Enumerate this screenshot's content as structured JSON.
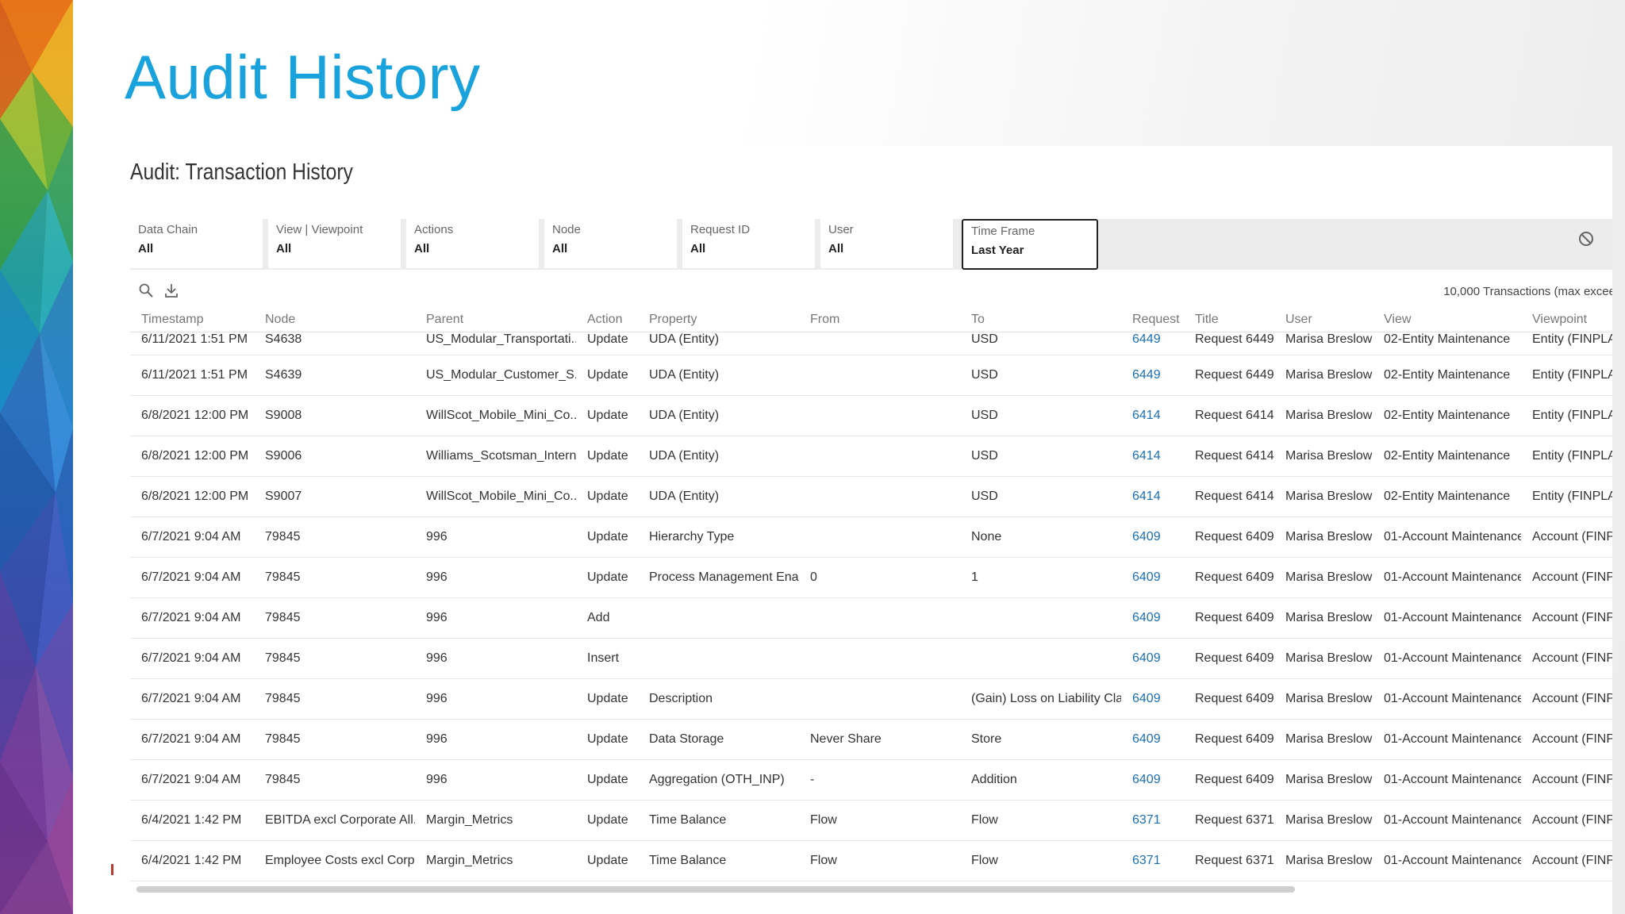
{
  "slide": {
    "title": "Audit History"
  },
  "app": {
    "title": "Audit: Transaction History",
    "filters": [
      {
        "label": "Data Chain",
        "value": "All"
      },
      {
        "label": "View | Viewpoint",
        "value": "All"
      },
      {
        "label": "Actions",
        "value": "All"
      },
      {
        "label": "Node",
        "value": "All"
      },
      {
        "label": "Request ID",
        "value": "All"
      },
      {
        "label": "User",
        "value": "All"
      },
      {
        "label": "Time Frame",
        "value": "Last Year"
      }
    ],
    "transactions_count": "10,000 Transactions (max excee",
    "columns": [
      "Timestamp",
      "Node",
      "Parent",
      "Action",
      "Property",
      "From",
      "To",
      "Request",
      "Title",
      "User",
      "View",
      "Viewpoint"
    ],
    "rows": [
      [
        "6/11/2021 1:51 PM",
        "S4638",
        "US_Modular_Transportati...",
        "Update",
        "UDA (Entity)",
        "",
        "USD",
        "6449",
        "Request 6449",
        "Marisa Breslow",
        "02-Entity Maintenance",
        "Entity (FINPLAN)"
      ],
      [
        "6/11/2021 1:51 PM",
        "S4639",
        "US_Modular_Customer_S...",
        "Update",
        "UDA (Entity)",
        "",
        "USD",
        "6449",
        "Request 6449",
        "Marisa Breslow",
        "02-Entity Maintenance",
        "Entity (FINPLAN)"
      ],
      [
        "6/8/2021 12:00 PM",
        "S9008",
        "WillScot_Mobile_Mini_Co...",
        "Update",
        "UDA (Entity)",
        "",
        "USD",
        "6414",
        "Request 6414",
        "Marisa Breslow",
        "02-Entity Maintenance",
        "Entity (FINPLAN)"
      ],
      [
        "6/8/2021 12:00 PM",
        "S9006",
        "Williams_Scotsman_Intern...",
        "Update",
        "UDA (Entity)",
        "",
        "USD",
        "6414",
        "Request 6414",
        "Marisa Breslow",
        "02-Entity Maintenance",
        "Entity (FINPLAN)"
      ],
      [
        "6/8/2021 12:00 PM",
        "S9007",
        "WillScot_Mobile_Mini_Co...",
        "Update",
        "UDA (Entity)",
        "",
        "USD",
        "6414",
        "Request 6414",
        "Marisa Breslow",
        "02-Entity Maintenance",
        "Entity (FINPLAN)"
      ],
      [
        "6/7/2021 9:04 AM",
        "79845",
        "996",
        "Update",
        "Hierarchy Type",
        "",
        "None",
        "6409",
        "Request 6409",
        "Marisa Breslow",
        "01-Account Maintenance",
        "Account (FINPLA"
      ],
      [
        "6/7/2021 9:04 AM",
        "79845",
        "996",
        "Update",
        "Process Management Ena...",
        "0",
        "1",
        "6409",
        "Request 6409",
        "Marisa Breslow",
        "01-Account Maintenance",
        "Account (FINPLA"
      ],
      [
        "6/7/2021 9:04 AM",
        "79845",
        "996",
        "Add",
        "",
        "",
        "",
        "6409",
        "Request 6409",
        "Marisa Breslow",
        "01-Account Maintenance",
        "Account (FINPLA"
      ],
      [
        "6/7/2021 9:04 AM",
        "79845",
        "996",
        "Insert",
        "",
        "",
        "",
        "6409",
        "Request 6409",
        "Marisa Breslow",
        "01-Account Maintenance",
        "Account (FINPLA"
      ],
      [
        "6/7/2021 9:04 AM",
        "79845",
        "996",
        "Update",
        "Description",
        "",
        "(Gain) Loss on Liability Cla...",
        "6409",
        "Request 6409",
        "Marisa Breslow",
        "01-Account Maintenance",
        "Account (FINPLA"
      ],
      [
        "6/7/2021 9:04 AM",
        "79845",
        "996",
        "Update",
        "Data Storage",
        "Never Share",
        "Store",
        "6409",
        "Request 6409",
        "Marisa Breslow",
        "01-Account Maintenance",
        "Account (FINPLA"
      ],
      [
        "6/7/2021 9:04 AM",
        "79845",
        "996",
        "Update",
        "Aggregation (OTH_INP)",
        "-",
        "Addition",
        "6409",
        "Request 6409",
        "Marisa Breslow",
        "01-Account Maintenance",
        "Account (FINPLA"
      ],
      [
        "6/4/2021 1:42 PM",
        "EBITDA excl Corporate All...",
        "Margin_Metrics",
        "Update",
        "Time Balance",
        "Flow",
        "Flow",
        "6371",
        "Request 6371",
        "Marisa Breslow",
        "01-Account Maintenance",
        "Account (FINPLA"
      ],
      [
        "6/4/2021 1:42 PM",
        "Employee Costs excl Corp...",
        "Margin_Metrics",
        "Update",
        "Time Balance",
        "Flow",
        "Flow",
        "6371",
        "Request 6371",
        "Marisa Breslow",
        "01-Account Maintenance",
        "Account (FINPLA"
      ]
    ]
  },
  "icons": {
    "search": "search-icon",
    "download": "download-icon",
    "clear_filters": "clear-filters-icon"
  },
  "colors": {
    "title": "#1aa2dc",
    "link": "#1b6fb5"
  }
}
